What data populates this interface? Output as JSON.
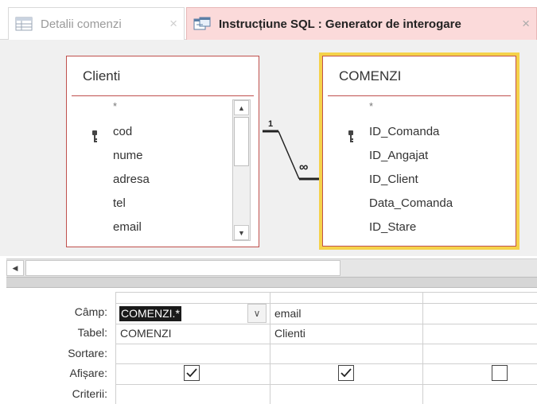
{
  "tabs": [
    {
      "label": "Detalii comenzi",
      "close": "×",
      "icon": "table-icon",
      "active": false
    },
    {
      "label": "Instrucțiune SQL : Generator de interogare",
      "close": "×",
      "icon": "query-icon",
      "active": true
    }
  ],
  "tables": {
    "clienti": {
      "title": "Clienti",
      "fields": [
        "*",
        "cod",
        "nume",
        "adresa",
        "tel",
        "email"
      ],
      "key_field": "cod"
    },
    "comenzi": {
      "title": "COMENZI",
      "fields": [
        "*",
        "ID_Comanda",
        "ID_Angajat",
        "ID_Client",
        "Data_Comanda",
        "ID_Stare"
      ],
      "key_field": "ID_Comanda"
    }
  },
  "relationship": {
    "one_side": "1",
    "many_side": "∞"
  },
  "grid": {
    "row_labels": {
      "field": "Câmp:",
      "table": "Tabel:",
      "sort": "Sortare:",
      "show": "Afișare:",
      "criteria": "Criterii:"
    },
    "columns": [
      {
        "field": "COMENZI.*",
        "table": "COMENZI",
        "show": true
      },
      {
        "field": "email",
        "table": "Clienti",
        "show": true
      },
      {
        "field": "",
        "table": "",
        "show": false
      }
    ]
  },
  "colors": {
    "accent_tab": "#fbdada",
    "table_border": "#c0504d",
    "selected_table_border": "#f5d24a"
  }
}
